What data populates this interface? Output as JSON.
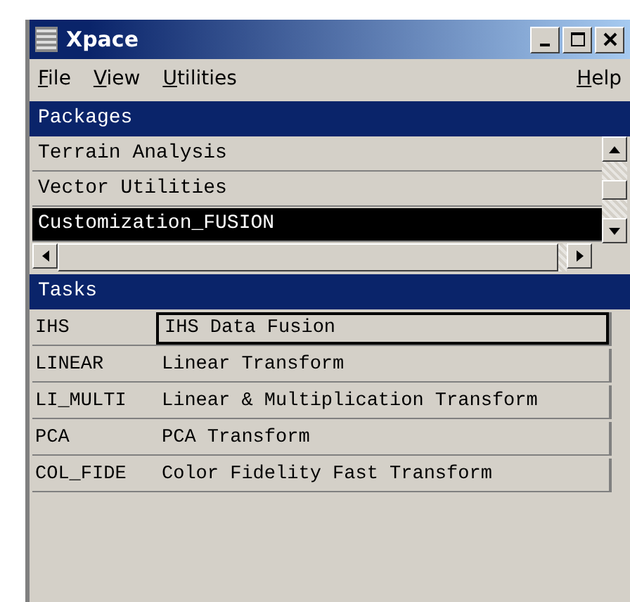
{
  "window": {
    "title": "Xpace"
  },
  "menu": {
    "left": [
      "File",
      "View",
      "Utilities"
    ],
    "right": [
      "Help"
    ]
  },
  "packages": {
    "title": "Packages",
    "items": [
      {
        "label": "Terrain Analysis",
        "selected": false
      },
      {
        "label": "Vector Utilities",
        "selected": false
      },
      {
        "label": "Customization_FUSION",
        "selected": true
      }
    ]
  },
  "tasks": {
    "title": "Tasks",
    "rows": [
      {
        "code": "IHS",
        "name": "IHS Data Fusion",
        "selected": true
      },
      {
        "code": "LINEAR",
        "name": "Linear Transform",
        "selected": false
      },
      {
        "code": "LI_MULTI",
        "name": "Linear & Multiplication Transform",
        "selected": false
      },
      {
        "code": "PCA",
        "name": "PCA Transform",
        "selected": false
      },
      {
        "code": "COL_FIDE",
        "name": "Color Fidelity Fast Transform",
        "selected": false
      }
    ]
  }
}
